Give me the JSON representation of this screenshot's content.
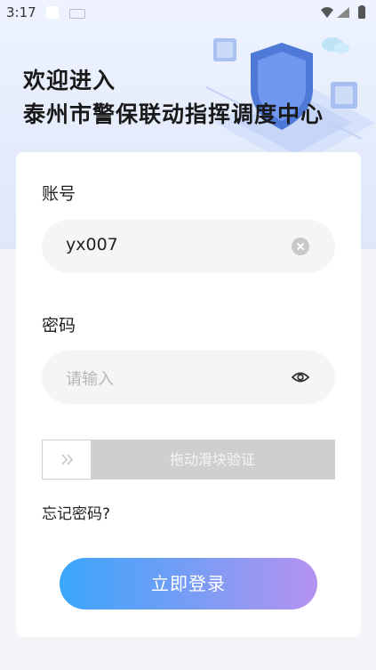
{
  "status_bar": {
    "time": "3:17"
  },
  "header": {
    "welcome_line1": "欢迎进入",
    "welcome_line2": "泰州市警保联动指挥调度中心"
  },
  "form": {
    "account_label": "账号",
    "account_value": "yx007",
    "password_label": "密码",
    "password_placeholder": "请输入",
    "slider_text": "拖动滑块验证",
    "forgot_link": "忘记密码?",
    "login_button": "立即登录"
  },
  "icons": {
    "clear": "clear-icon",
    "eye": "eye-icon",
    "slider_arrow": "double-chevron-right-icon",
    "wifi": "wifi-icon",
    "signal": "signal-icon",
    "battery": "battery-icon"
  },
  "colors": {
    "login_gradient_start": "#3aa6fb",
    "login_gradient_end": "#b592f0",
    "slider_track": "#cfcfcf"
  }
}
